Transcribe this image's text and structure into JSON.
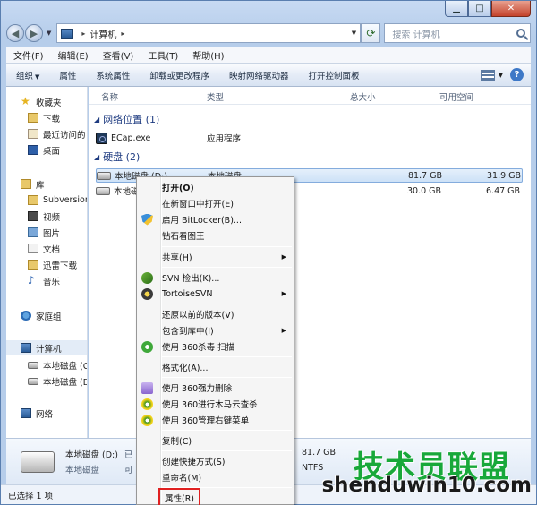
{
  "window": {
    "caption_buttons": [
      "minimize",
      "maximize",
      "close"
    ]
  },
  "address_bar": {
    "path_root_icon": "computer-icon",
    "path": "计算机",
    "search_placeholder": "搜索 计算机"
  },
  "menubar": [
    "文件(F)",
    "编辑(E)",
    "查看(V)",
    "工具(T)",
    "帮助(H)"
  ],
  "commandbar": {
    "organize": "组织",
    "properties": "属性",
    "system_properties": "系统属性",
    "uninstall": "卸载或更改程序",
    "map_drive": "映射网络驱动器",
    "control_panel": "打开控制面板"
  },
  "nav_pane": {
    "favorites": "收藏夹",
    "downloads": "下载",
    "recent": "最近访问的",
    "desktop": "桌面",
    "libraries": "库",
    "subversion": "Subversion",
    "videos": "视频",
    "pictures": "图片",
    "documents": "文档",
    "xunlei": "迅雷下载",
    "music": "音乐",
    "homegroup": "家庭组",
    "computer": "计算机",
    "local_c": "本地磁盘 (C",
    "local_d": "本地磁盘 (D",
    "network": "网络"
  },
  "columns": {
    "name": "名称",
    "type": "类型",
    "total": "总大小",
    "free": "可用空间"
  },
  "groups": {
    "network_location": "网络位置 (1)",
    "hard_disk": "硬盘 (2)"
  },
  "items": {
    "ecap": {
      "name": "ECap.exe",
      "type": "应用程序"
    },
    "drive_d": {
      "name": "本地磁盘 (D:)",
      "type": "本地磁盘",
      "total": "81.7 GB",
      "free": "31.9 GB"
    },
    "drive_other": {
      "name": "本地磁",
      "total": "30.0 GB",
      "free": "6.47 GB"
    }
  },
  "details": {
    "name": "本地磁盘 (D:)",
    "type": "本地磁盘",
    "used_label": "已",
    "free_label": "可",
    "total_value": "81.7 GB",
    "fs": "NTFS"
  },
  "status": "已选择 1 项",
  "context_menu": {
    "open": "打开(O)",
    "open_new_window": "在新窗口中打开(E)",
    "bitlocker": "启用 BitLocker(B)...",
    "diamond": "钻石看图王",
    "share": "共享(H)",
    "svn_checkout": "SVN 检出(K)...",
    "tortoisesvn": "TortoiseSVN",
    "restore_prev": "还原以前的版本(V)",
    "include_library": "包含到库中(I)",
    "scan_360": "使用 360杀毒 扫描",
    "format": "格式化(A)...",
    "force_delete": "使用 360强力删除",
    "trojan": "使用 360进行木马云查杀",
    "right_menu": "使用 360管理右键菜单",
    "copy": "复制(C)",
    "create_shortcut": "创建快捷方式(S)",
    "rename": "重命名(M)",
    "properties": "属性(R)"
  },
  "watermark": {
    "cn": "技术员联盟",
    "url": "shenduwin10.com"
  }
}
